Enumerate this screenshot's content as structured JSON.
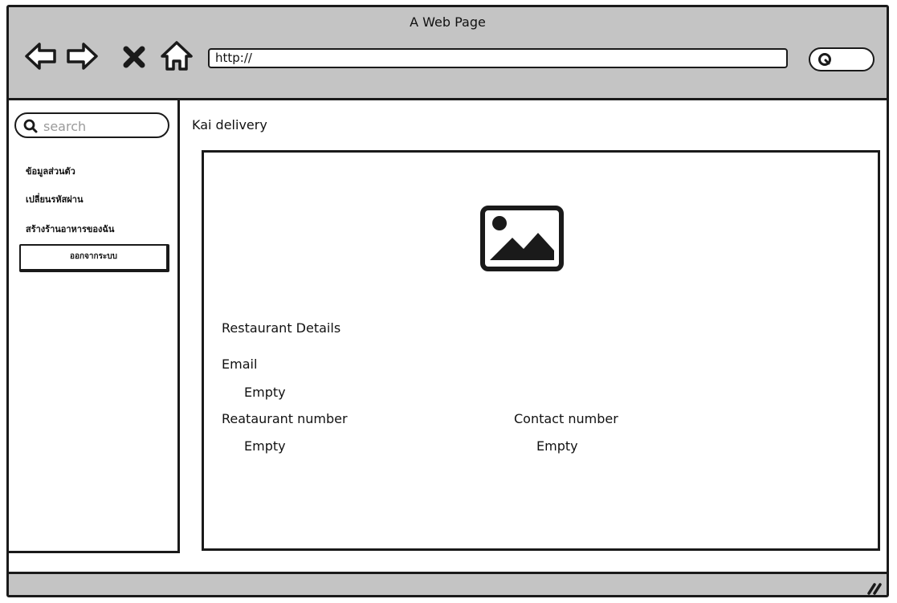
{
  "window": {
    "title": "A Web Page"
  },
  "toolbar": {
    "back_icon": "back-arrow-icon",
    "forward_icon": "forward-arrow-icon",
    "stop_icon": "close-icon",
    "home_icon": "home-icon",
    "url": "http://",
    "search_icon": "search-icon"
  },
  "sidebar": {
    "search": {
      "placeholder": "search",
      "icon": "search-icon"
    },
    "items": [
      {
        "label": "ข้อมูลส่วนตัว"
      },
      {
        "label": "เปลี่ยนรหัสผ่าน"
      },
      {
        "label": "สร้างร้านอาหารของฉัน"
      }
    ],
    "logout_label": "ออกจากระบบ"
  },
  "main": {
    "page_title": "Kai delivery",
    "image_icon": "image-placeholder-icon",
    "section_heading": "Restaurant Details",
    "fields": {
      "email": {
        "label": "Email",
        "value": "Empty"
      },
      "restaurant_number": {
        "label": "Reataurant number",
        "value": "Empty"
      },
      "contact_number": {
        "label": "Contact number",
        "value": "Empty"
      }
    }
  },
  "colors": {
    "chrome_bg": "#c4c4c4",
    "stroke": "#1a1a1a",
    "placeholder_text": "#9a9a9a"
  }
}
